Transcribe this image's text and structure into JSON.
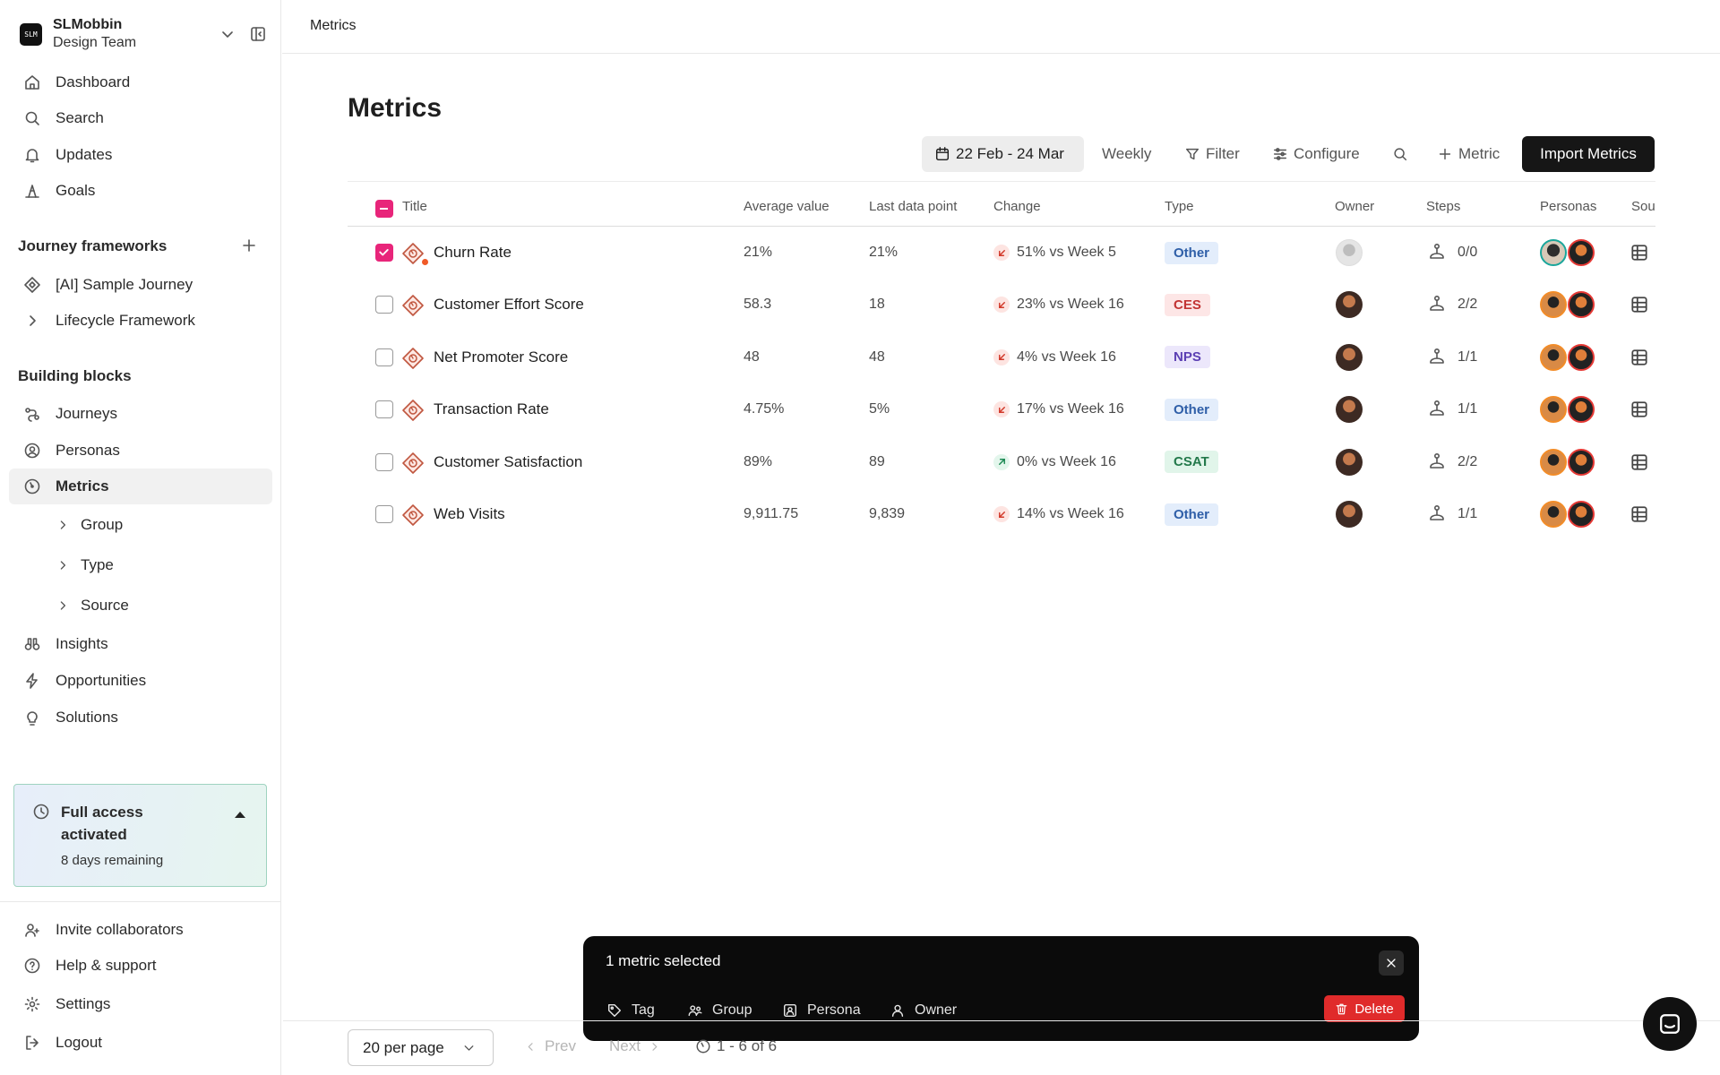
{
  "workspace": {
    "name": "SLMobbin",
    "team": "Design Team",
    "logo_text": "SLM"
  },
  "nav": {
    "dashboard": "Dashboard",
    "search": "Search",
    "updates": "Updates",
    "goals": "Goals",
    "journey_frameworks_title": "Journey frameworks",
    "sample_journey": "[AI] Sample Journey",
    "lifecycle": "Lifecycle Framework",
    "building_blocks_title": "Building blocks",
    "journeys": "Journeys",
    "personas": "Personas",
    "metrics": "Metrics",
    "group": "Group",
    "type": "Type",
    "source": "Source",
    "insights": "Insights",
    "opportunities": "Opportunities",
    "solutions": "Solutions",
    "invite": "Invite collaborators",
    "help": "Help & support",
    "settings": "Settings",
    "logout": "Logout"
  },
  "trial": {
    "title": "Full access activated",
    "remaining": "8 days remaining"
  },
  "breadcrumb": "Metrics",
  "page_title": "Metrics",
  "toolbar": {
    "date_range": "22 Feb - 24 Mar",
    "interval": "Weekly",
    "filter": "Filter",
    "configure": "Configure",
    "add_metric": "Metric",
    "import": "Import Metrics"
  },
  "columns": {
    "title": "Title",
    "average": "Average value",
    "last": "Last data point",
    "change": "Change",
    "type": "Type",
    "owner": "Owner",
    "steps": "Steps",
    "personas": "Personas",
    "source": "Sou"
  },
  "rows": [
    {
      "title": "Churn Rate",
      "average": "21%",
      "last": "21%",
      "change": "51% vs Week 5",
      "trend": "down",
      "type": "Other",
      "steps": "0/0",
      "checked": true
    },
    {
      "title": "Customer Effort Score",
      "average": "58.3",
      "last": "18",
      "change": "23% vs Week 16",
      "trend": "down",
      "type": "CES",
      "steps": "2/2",
      "checked": false
    },
    {
      "title": "Net Promoter Score",
      "average": "48",
      "last": "48",
      "change": "4% vs Week 16",
      "trend": "down",
      "type": "NPS",
      "steps": "1/1",
      "checked": false
    },
    {
      "title": "Transaction Rate",
      "average": "4.75%",
      "last": "5%",
      "change": "17% vs Week 16",
      "trend": "down",
      "type": "Other",
      "steps": "1/1",
      "checked": false
    },
    {
      "title": "Customer Satisfaction",
      "average": "89%",
      "last": "89",
      "change": "0% vs Week 16",
      "trend": "up",
      "type": "CSAT",
      "steps": "2/2",
      "checked": false
    },
    {
      "title": "Web Visits",
      "average": "9,911.75",
      "last": "9,839",
      "change": "14% vs Week 16",
      "trend": "down",
      "type": "Other",
      "steps": "1/1",
      "checked": false
    }
  ],
  "type_colors": {
    "Other": {
      "bg": "#e3edfb",
      "fg": "#2f5fa8"
    },
    "CES": {
      "bg": "#fde6e6",
      "fg": "#c23434"
    },
    "NPS": {
      "bg": "#ece7fb",
      "fg": "#5b3fb3"
    },
    "CSAT": {
      "bg": "#e1f5ea",
      "fg": "#23794b"
    }
  },
  "selection_bar": {
    "count": "1 metric selected",
    "tag": "Tag",
    "group": "Group",
    "persona": "Persona",
    "owner": "Owner",
    "delete": "Delete"
  },
  "pagination": {
    "per_page": "20 per page",
    "prev": "Prev",
    "next": "Next",
    "range": "1 - 6 of 6"
  },
  "colors": {
    "accent": "#e8257a",
    "danger": "#e02b2b",
    "dark": "#161616"
  }
}
